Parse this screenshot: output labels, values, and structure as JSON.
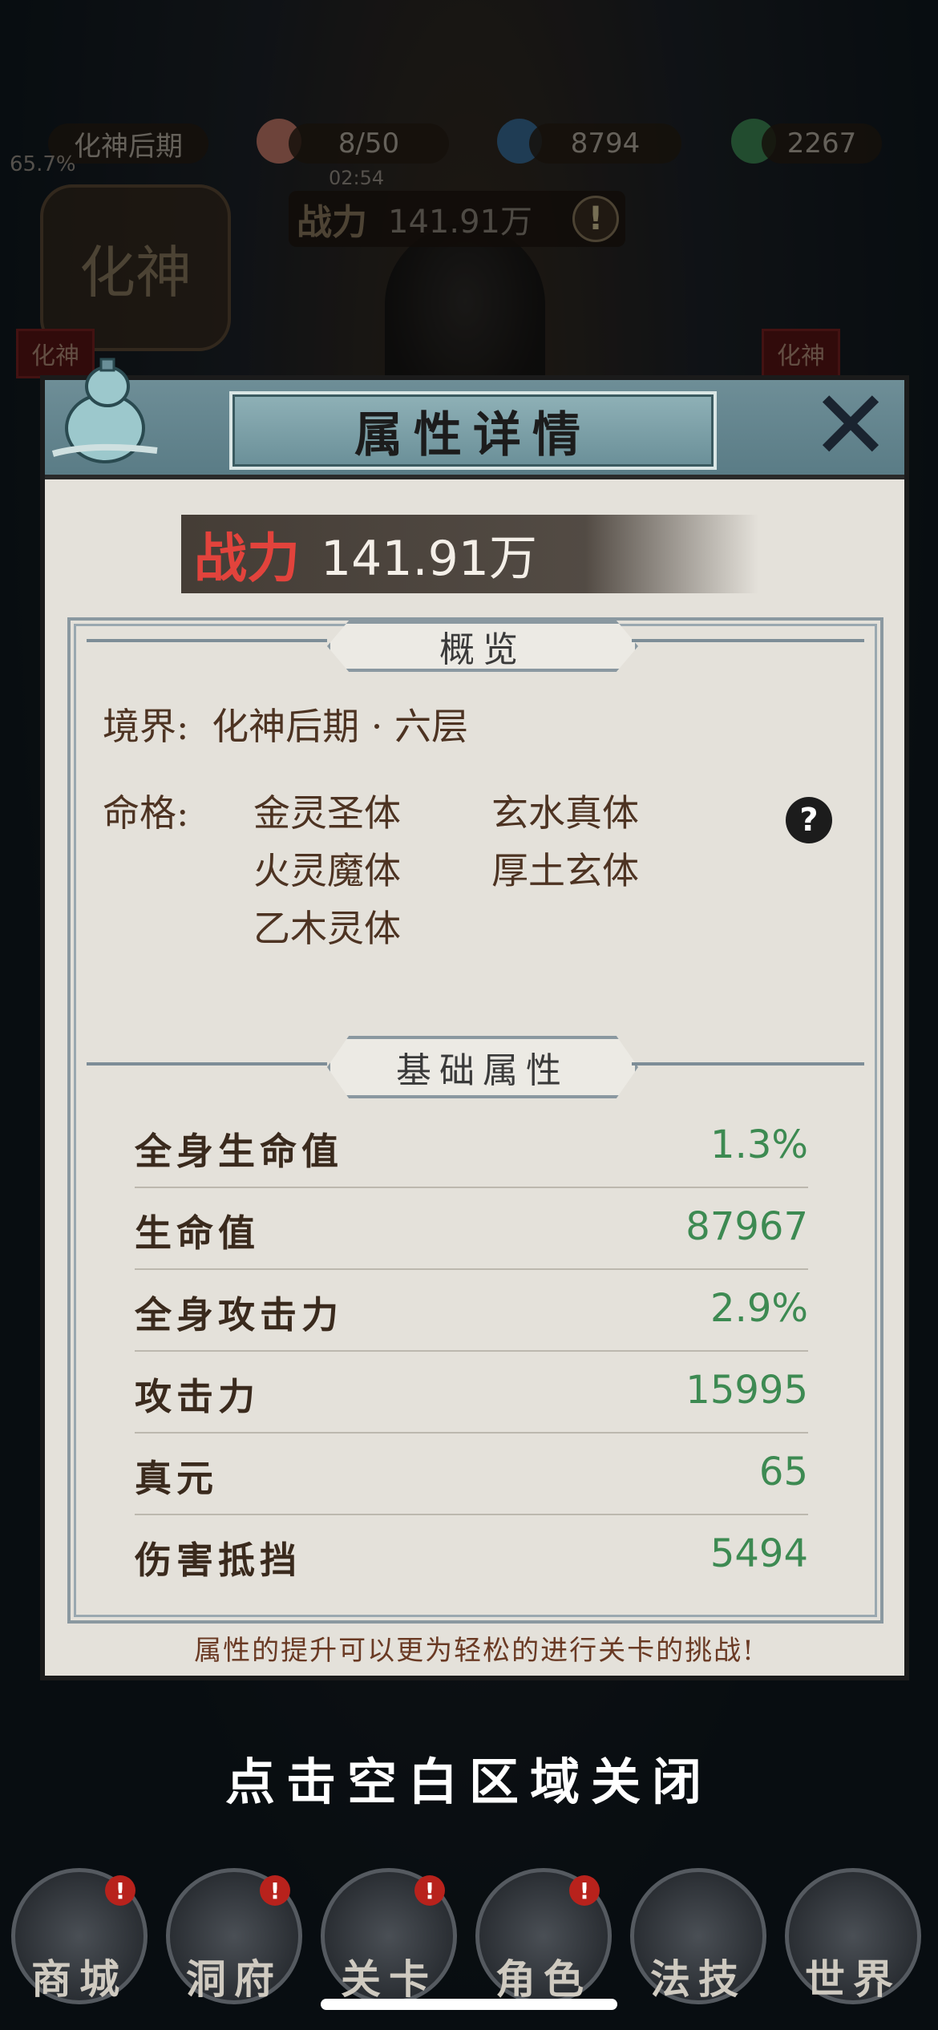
{
  "background": {
    "realm_label": "化神后期",
    "progress_percent": "65.7%",
    "resources": [
      {
        "icon": "peach-icon",
        "value": "8/50"
      },
      {
        "icon": "gem-icon",
        "value": "8794"
      },
      {
        "icon": "jade-icon",
        "value": "2267"
      }
    ],
    "timer": "02:54",
    "power_label": "战力",
    "power_value": "141.91万",
    "realm_badge": "化神",
    "side_tag_left": "化神",
    "side_tag_right": "化神"
  },
  "panel": {
    "title": "属性详情",
    "close_icon": "close-icon",
    "power_label": "战力",
    "power_value": "141.91万",
    "overview": {
      "heading": "概览",
      "realm_label": "境界:",
      "realm_value": "化神后期 · 六层",
      "fate_label": "命格:",
      "fates": [
        "金灵圣体",
        "玄水真体",
        "火灵魔体",
        "厚土玄体",
        "乙木灵体"
      ],
      "help_icon": "?"
    },
    "basic": {
      "heading": "基础属性",
      "rows": [
        {
          "name": "全身生命值",
          "value": "1.3%"
        },
        {
          "name": "生命值",
          "value": "87967"
        },
        {
          "name": "全身攻击力",
          "value": "2.9%"
        },
        {
          "name": "攻击力",
          "value": "15995"
        },
        {
          "name": "真元",
          "value": "65"
        },
        {
          "name": "伤害抵挡",
          "value": "5494"
        }
      ]
    },
    "footer_note": "属性的提升可以更为轻松的进行关卡的挑战!"
  },
  "close_hint": "点击空白区域关闭",
  "bottom_nav": [
    {
      "label": "商城",
      "badge": "!"
    },
    {
      "label": "洞府",
      "badge": "!"
    },
    {
      "label": "关卡",
      "badge": "!"
    },
    {
      "label": "角色",
      "badge": "!"
    },
    {
      "label": "法技",
      "badge": ""
    },
    {
      "label": "世界",
      "badge": ""
    }
  ],
  "colors": {
    "value_green": "#3d8a52",
    "power_red": "#e2433c",
    "panel_bg": "#e4e1da",
    "header_teal": "#5a7c86"
  }
}
